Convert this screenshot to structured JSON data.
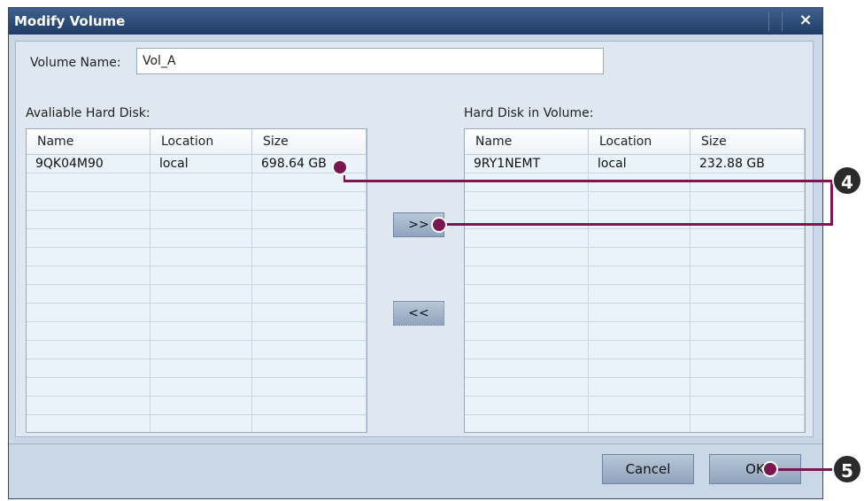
{
  "dialog": {
    "title": "Modify Volume",
    "close_glyph": "×"
  },
  "volume": {
    "label": "Volume Name:",
    "value": "Vol_A"
  },
  "available": {
    "label": "Avaliable Hard Disk:",
    "columns": [
      "Name",
      "Location",
      "Size"
    ],
    "rows": [
      [
        "9QK04M90",
        "local",
        "698.64 GB"
      ]
    ]
  },
  "in_volume": {
    "label": "Hard Disk in Volume:",
    "columns": [
      "Name",
      "Location",
      "Size"
    ],
    "rows": [
      [
        "9RY1NEMT",
        "local",
        "232.88 GB"
      ]
    ]
  },
  "buttons": {
    "add": ">>",
    "remove": "<<",
    "cancel": "Cancel",
    "ok": "OK"
  },
  "callouts": {
    "step_add": "4",
    "step_ok": "5"
  },
  "colors": {
    "accent": "#7b1650",
    "titlebar": "#1f3d66"
  }
}
